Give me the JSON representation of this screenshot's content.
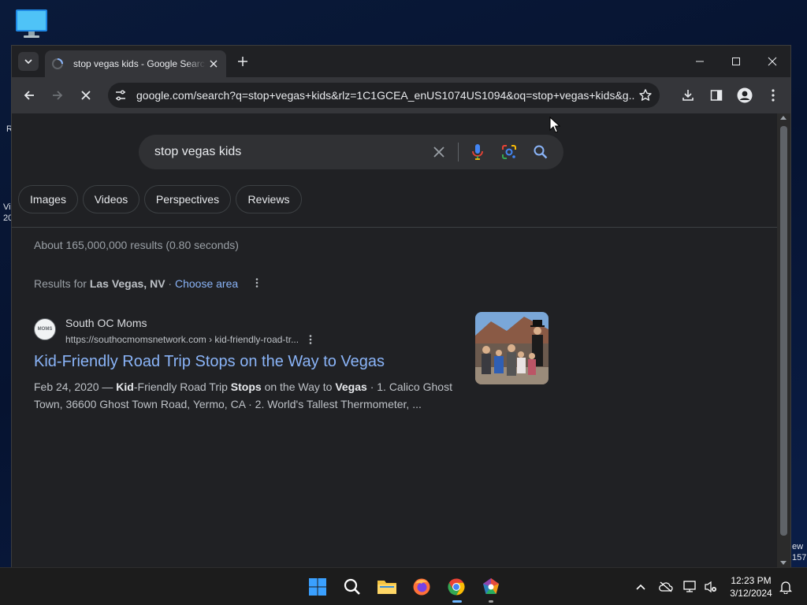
{
  "desktop": {
    "left_fragments": [
      "R",
      "Vi",
      "20"
    ],
    "right_fragments": [
      "ew",
      "157"
    ]
  },
  "browser": {
    "tab": {
      "title": "stop vegas kids - Google Search"
    },
    "address_bar": {
      "url": "google.com/search?q=stop+vegas+kids&rlz=1C1GCEA_enUS1074US1094&oq=stop+vegas+kids&g..."
    }
  },
  "search": {
    "query": "stop vegas kids",
    "chips": [
      "Images",
      "Videos",
      "Perspectives",
      "Reviews"
    ],
    "stats": "About 165,000,000 results (0.80 seconds)",
    "location": {
      "prefix": "Results for ",
      "place": "Las Vegas, NV",
      "separator": " · ",
      "link": "Choose area"
    }
  },
  "result": {
    "site_favicon_text": "MOMS",
    "site_name": "South OC Moms",
    "url": "https://southocmomsnetwork.com › kid-friendly-road-tr...",
    "title": "Kid-Friendly Road Trip Stops on the Way to Vegas",
    "snippet": {
      "date": "Feb 24, 2020",
      "dash": " — ",
      "w1": "Kid",
      "t1": "-Friendly Road Trip ",
      "w2": "Stops",
      "t2": " on the Way to ",
      "w3": "Vegas",
      "t3": " · 1. Calico Ghost Town, 36600 Ghost Town Road, Yermo, CA · 2. World's Tallest Thermometer, ..."
    }
  },
  "taskbar": {
    "time": "12:23 PM",
    "date": "3/12/2024"
  },
  "colors": {
    "link": "#8ab4f8",
    "page_bg": "#202124",
    "toolbar_bg": "#35363a",
    "accent": "#6cb6ff"
  }
}
